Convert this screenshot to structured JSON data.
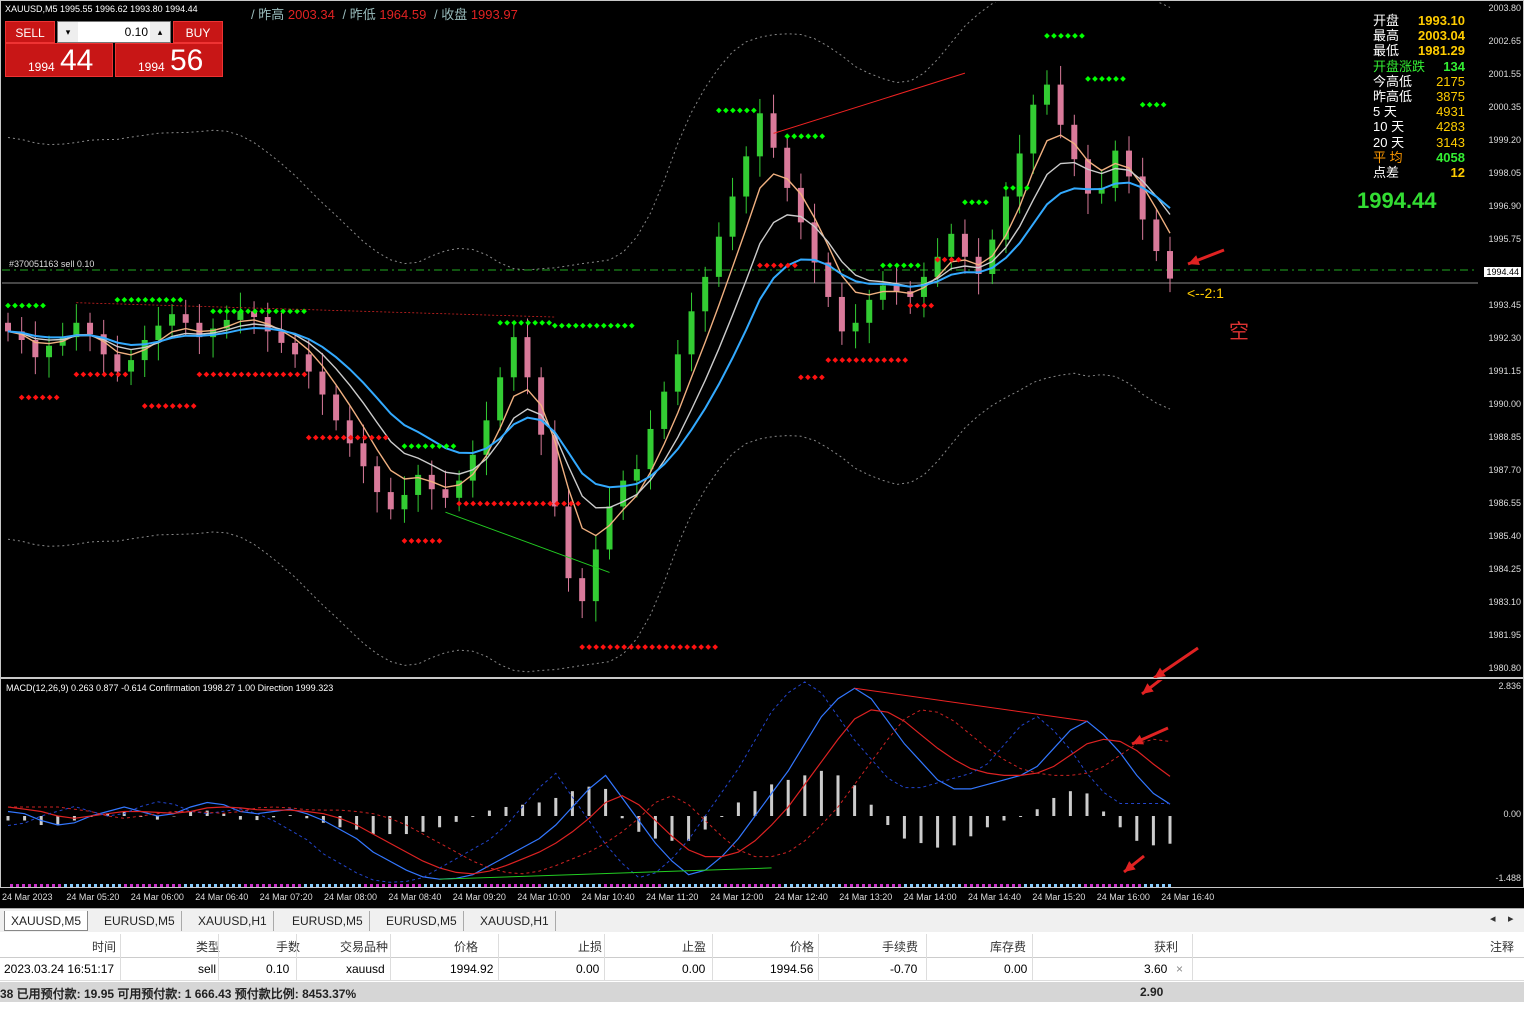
{
  "chart_header": {
    "symbol_line": "XAUUSD,M5  1995.55 1996.62 1993.80 1994.44",
    "prev_high_label": "/ 昨高",
    "prev_high": "2003.34",
    "prev_low_label": "/ 昨低",
    "prev_low": "1964.59",
    "close_label": "/ 收盘",
    "close": "1993.97"
  },
  "trade_panel": {
    "sell_label": "SELL",
    "buy_label": "BUY",
    "lot": "0.10",
    "sell_small": "1994",
    "sell_big": "44",
    "buy_small": "1994",
    "buy_big": "56"
  },
  "info_panel": [
    {
      "k": "开盘",
      "v": "1993.10",
      "style": ""
    },
    {
      "k": "最高",
      "v": "2003.04",
      "style": ""
    },
    {
      "k": "最低",
      "v": "1981.29",
      "style": ""
    },
    {
      "k": "开盘涨跌",
      "v": "134",
      "style": "green"
    },
    {
      "k": "今高低",
      "v": "2175",
      "style": "plain"
    },
    {
      "k": "昨高低",
      "v": "3875",
      "style": "plain"
    },
    {
      "k": "5  天",
      "v": "4931",
      "style": "plain"
    },
    {
      "k": "10 天",
      "v": "4283",
      "style": "plain"
    },
    {
      "k": "20 天",
      "v": "3143",
      "style": "plain"
    },
    {
      "k": "平 均",
      "v": "4058",
      "style": "orange"
    },
    {
      "k": "点差",
      "v": "12",
      "style": ""
    }
  ],
  "current_price": "1994.44",
  "order_line_label": "#370051163 sell 0.10",
  "ratio_label": "<--2:1",
  "direction_label": "空",
  "price_axis": {
    "ticks": [
      "2003.80",
      "2002.65",
      "2001.55",
      "2000.35",
      "1999.20",
      "1998.05",
      "1996.90",
      "1995.75",
      "1994.44",
      "1993.45",
      "1992.30",
      "1991.15",
      "1990.00",
      "1988.85",
      "1987.70",
      "1986.55",
      "1985.40",
      "1984.25",
      "1983.10",
      "1981.95",
      "1980.80"
    ],
    "current_tag": "1994.44"
  },
  "macd": {
    "label": "MACD(12,26,9) 0.263 0.877 -0.614  Confirmation 1998.27 1.00  Direction 1999.323",
    "ticks": [
      "2.836",
      "0.00",
      "-1.488"
    ]
  },
  "time_axis": [
    "24 Mar 2023",
    "24 Mar 05:20",
    "24 Mar 06:00",
    "24 Mar 06:40",
    "24 Mar 07:20",
    "24 Mar 08:00",
    "24 Mar 08:40",
    "24 Mar 09:20",
    "24 Mar 10:00",
    "24 Mar 10:40",
    "24 Mar 11:20",
    "24 Mar 12:00",
    "24 Mar 12:40",
    "24 Mar 13:20",
    "24 Mar 14:00",
    "24 Mar 14:40",
    "24 Mar 15:20",
    "24 Mar 16:00",
    "24 Mar 16:40"
  ],
  "tabs": [
    "XAUUSD,M5",
    "EURUSD,M5",
    "XAUUSD,H1",
    "EURUSD,M5",
    "EURUSD,M5",
    "XAUUSD,H1"
  ],
  "tab_nav": {
    "left": "◂",
    "right": "▸"
  },
  "table": {
    "headers": [
      "时间",
      "类型",
      "手数",
      "交易品种",
      "价格",
      "止损",
      "止盈",
      "价格",
      "手续费",
      "库存费",
      "获利",
      "注释"
    ],
    "row": [
      "2023.03.24 16:51:17",
      "sell",
      "0.10",
      "xauusd",
      "1994.92",
      "0.00",
      "0.00",
      "1994.56",
      "-0.70",
      "0.00",
      "3.60"
    ],
    "close_icon": "×",
    "summary": "38  已用预付款: 19.95  可用预付款: 1 666.43  预付款比例: 8453.37%",
    "summary_total": "2.90"
  },
  "chart_data": {
    "type": "candlestick",
    "symbol": "XAUUSD",
    "timeframe": "M5",
    "ylim": [
      1980.8,
      2003.8
    ],
    "ohlc_last": {
      "open": 1995.55,
      "high": 1996.62,
      "low": 1993.8,
      "close": 1994.44
    },
    "close_series": [
      1992.6,
      1992.3,
      1991.7,
      1992.1,
      1992.4,
      1992.9,
      1992.5,
      1991.8,
      1991.2,
      1991.6,
      1992.3,
      1992.8,
      1993.2,
      1992.9,
      1992.4,
      1992.7,
      1993.0,
      1993.3,
      1993.1,
      1992.6,
      1992.2,
      1991.8,
      1991.2,
      1990.4,
      1989.5,
      1988.7,
      1987.9,
      1987.0,
      1986.4,
      1986.9,
      1987.6,
      1987.1,
      1986.8,
      1987.4,
      1988.3,
      1989.5,
      1991.0,
      1992.4,
      1991.0,
      1989.0,
      1986.5,
      1984.0,
      1983.2,
      1985.0,
      1986.5,
      1987.4,
      1987.8,
      1989.2,
      1990.5,
      1991.8,
      1993.3,
      1994.5,
      1995.9,
      1997.3,
      1998.7,
      2000.2,
      1999.0,
      1997.6,
      1996.4,
      1995.0,
      1993.8,
      1992.6,
      1992.9,
      1993.7,
      1994.2,
      1994.0,
      1993.8,
      1994.5,
      1995.2,
      1996.0,
      1995.2,
      1994.6,
      1995.8,
      1997.3,
      1998.8,
      2000.5,
      2001.2,
      1999.8,
      1998.6,
      1997.4,
      1997.6,
      1998.9,
      1998.0,
      1996.5,
      1995.4,
      1994.44
    ],
    "macd_line": [
      0.1,
      0.05,
      -0.1,
      -0.2,
      -0.15,
      0.0,
      0.1,
      0.2,
      0.1,
      0.0,
      0.05,
      0.2,
      0.3,
      0.25,
      0.1,
      0.05,
      0.1,
      0.15,
      0.05,
      -0.1,
      -0.3,
      -0.5,
      -0.8,
      -1.0,
      -1.2,
      -1.35,
      -1.4,
      -1.38,
      -1.3,
      -1.1,
      -0.9,
      -0.7,
      -0.5,
      -0.2,
      0.2,
      0.6,
      0.9,
      0.4,
      -0.1,
      -0.6,
      -1.0,
      -1.3,
      -1.2,
      -0.9,
      -0.5,
      0.0,
      0.5,
      1.0,
      1.6,
      2.2,
      2.6,
      2.83,
      2.6,
      2.1,
      1.6,
      1.2,
      0.8,
      0.6,
      0.6,
      0.7,
      0.8,
      0.9,
      1.1,
      1.5,
      1.9,
      2.1,
      1.8,
      1.4,
      0.9,
      0.5,
      0.263
    ],
    "signal_line": [
      0.2,
      0.15,
      0.1,
      0.0,
      -0.05,
      0.0,
      0.05,
      0.1,
      0.1,
      0.08,
      0.06,
      0.1,
      0.18,
      0.2,
      0.18,
      0.14,
      0.13,
      0.13,
      0.1,
      0.05,
      -0.05,
      -0.2,
      -0.4,
      -0.6,
      -0.8,
      -1.0,
      -1.15,
      -1.25,
      -1.28,
      -1.22,
      -1.1,
      -0.95,
      -0.8,
      -0.6,
      -0.35,
      -0.05,
      0.3,
      0.45,
      0.25,
      -0.1,
      -0.45,
      -0.75,
      -0.9,
      -0.9,
      -0.8,
      -0.55,
      -0.2,
      0.2,
      0.7,
      1.2,
      1.7,
      2.15,
      2.35,
      2.3,
      2.1,
      1.8,
      1.5,
      1.25,
      1.05,
      0.95,
      0.9,
      0.9,
      0.95,
      1.1,
      1.35,
      1.6,
      1.7,
      1.65,
      1.45,
      1.15,
      0.877
    ],
    "histogram": [
      -0.1,
      -0.1,
      -0.2,
      -0.2,
      -0.1,
      0.0,
      0.05,
      0.1,
      0.0,
      -0.08,
      -0.01,
      0.1,
      0.12,
      0.05,
      -0.08,
      -0.09,
      -0.03,
      0.02,
      -0.05,
      -0.15,
      -0.25,
      -0.3,
      -0.4,
      -0.4,
      -0.4,
      -0.35,
      -0.25,
      -0.13,
      -0.02,
      0.12,
      0.2,
      0.25,
      0.3,
      0.4,
      0.55,
      0.65,
      0.6,
      -0.05,
      -0.35,
      -0.5,
      -0.55,
      -0.55,
      -0.3,
      0.0,
      0.3,
      0.55,
      0.7,
      0.8,
      0.9,
      1.0,
      0.9,
      0.68,
      0.25,
      -0.2,
      -0.5,
      -0.6,
      -0.7,
      -0.65,
      -0.45,
      -0.25,
      -0.1,
      0.0,
      0.15,
      0.4,
      0.55,
      0.5,
      0.1,
      -0.25,
      -0.55,
      -0.65,
      -0.614
    ]
  },
  "colors": {
    "bull": "#33cc33",
    "bear": "#d97a9a",
    "ema_fast": "#33aaff",
    "ema_slow": "#cccccc",
    "ema_orange": "#f0b080",
    "dots_green": "#00ff00",
    "dots_red": "#ff1111",
    "band": "#888888",
    "accent_red": "#e02222"
  }
}
